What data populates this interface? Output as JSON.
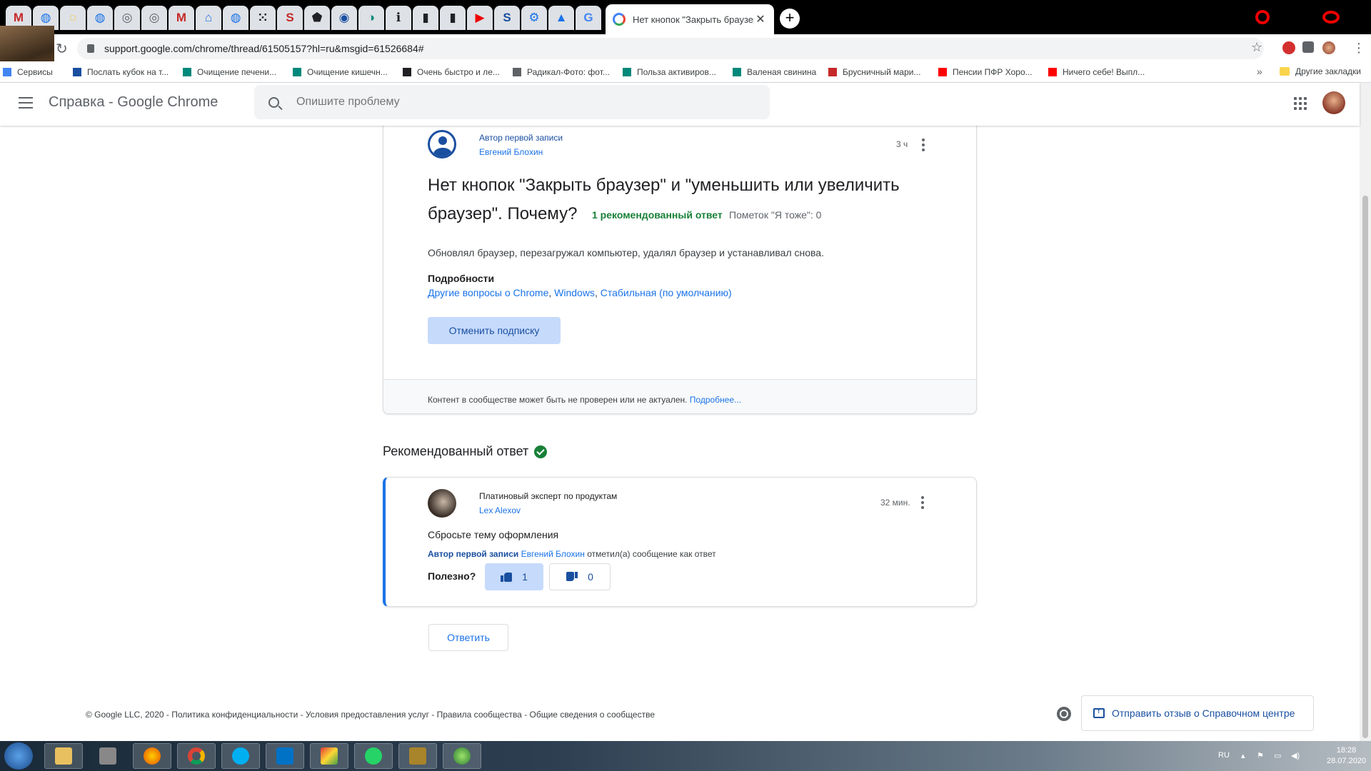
{
  "browser": {
    "active_tab_title": "Нет кнопок \"Закрыть браузер\"",
    "close_tab": "✕",
    "new_tab": "+",
    "url": "support.google.com/chrome/thread/61505157?hl=ru&msgid=61526684#",
    "bookmarks": [
      "Сервисы",
      "Послать кубок на т...",
      "Очищение печени...",
      "Очищение кишечн...",
      "Очень быстро и ле...",
      "Радикал-Фото: фот...",
      "Польза активиров...",
      "Валеная свинина",
      "Брусничный мари...",
      "Пенсии ПФР Хоро...",
      "Ничего себе! Выпл..."
    ],
    "bookmarks_more": "»",
    "other_bookmarks": "Другие закладки",
    "tab_icons": [
      "M",
      "◍",
      "◌",
      "◍",
      "◎",
      "◎",
      "M",
      "⌂",
      "◍",
      "⁙",
      "S",
      "⬟",
      "◉",
      "◑",
      "ℹ",
      "▮",
      "▮",
      "▶",
      "S",
      "⚙",
      "▲",
      "G"
    ]
  },
  "header": {
    "product_title": "Справка - Google Chrome",
    "search_placeholder": "Опишите проблему"
  },
  "question": {
    "role": "Автор первой записи",
    "author": "Евгений Блохин",
    "time": "3 ч",
    "title": "Нет кнопок \"Закрыть браузер\" и \"уменьшить или увеличить браузер\". Почему?",
    "recommended_count": "1 рекомендованный ответ",
    "me_too": "Пометок \"Я тоже\": 0",
    "body": "Обновлял браузер, перезагружал компьютер, удалял браузер и устанавливал снова.",
    "details_heading": "Подробности",
    "details_links": [
      "Другие вопросы о Chrome",
      "Windows",
      "Стабильная (по умолчанию)"
    ],
    "unsubscribe_label": "Отменить подписку",
    "disclaimer": "Контент в сообществе может быть не проверен или не актуален.",
    "disclaimer_link": "Подробнее..."
  },
  "recommended": {
    "heading": "Рекомендованный ответ",
    "role": "Платиновый эксперт по продуктам",
    "author": "Lex Alexov",
    "time": "32 мин.",
    "text": "Сбросьте тему оформления",
    "marked_author_role": "Автор первой записи",
    "marked_author": "Евгений Блохин",
    "marked_suffix": "отметил(а) сообщение как ответ",
    "helpful_label": "Полезно?",
    "upvotes": "1",
    "downvotes": "0"
  },
  "reply_label": "Ответить",
  "footer": {
    "links": "© Google LLC, 2020 - Политика конфиденциальности - Условия предоставления услуг - Правила сообщества - Общие сведения о сообществе",
    "feedback_label": "Отправить отзыв о Справочном центре"
  },
  "taskbar": {
    "lang": "RU",
    "time": "18:28",
    "date": "28.07.2020"
  },
  "colors": {
    "accent": "#1a73e8",
    "recommended_green": "#188038"
  }
}
